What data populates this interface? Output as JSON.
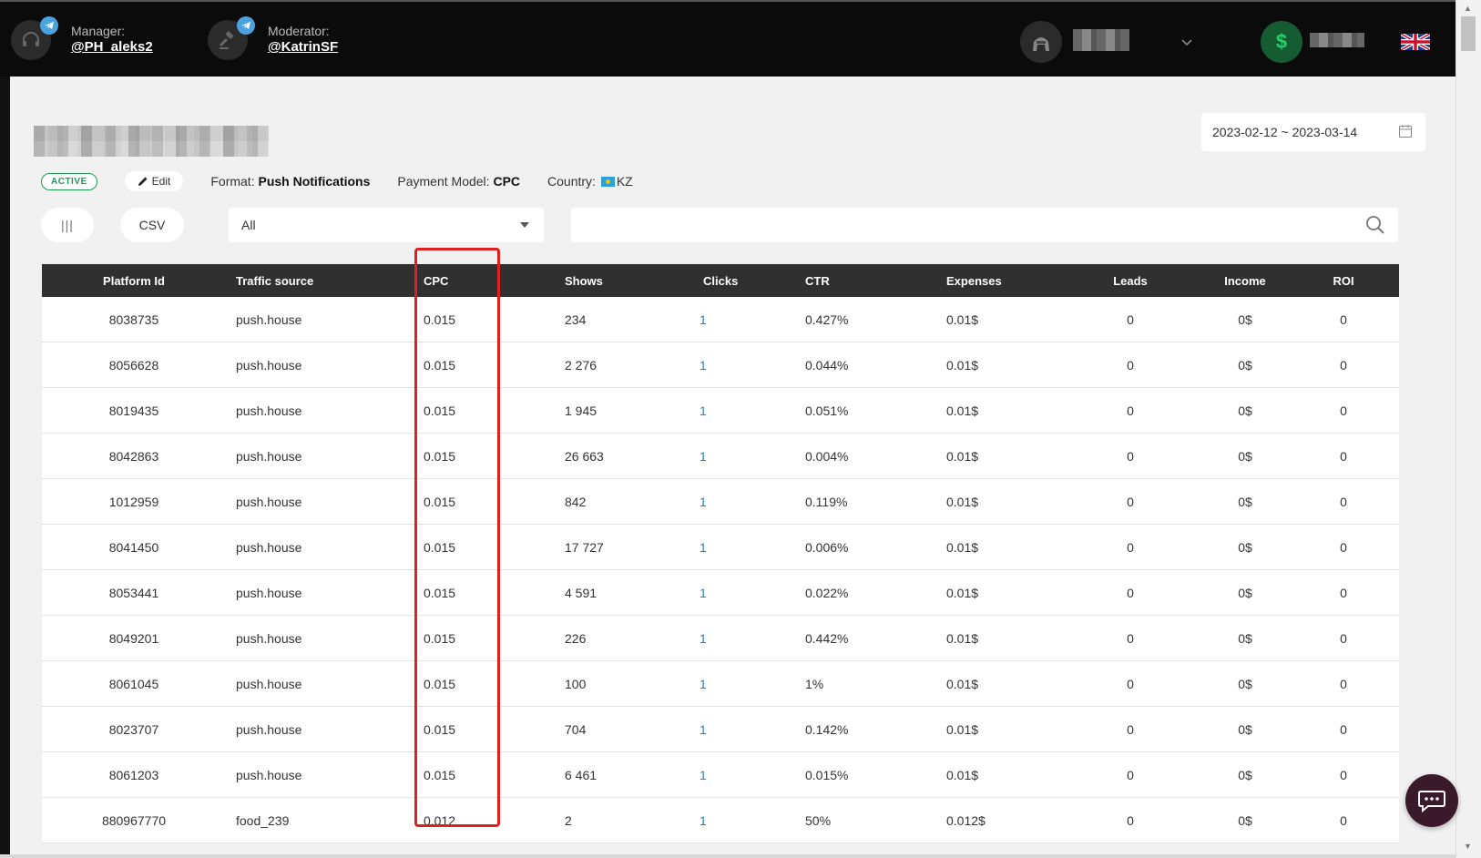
{
  "header": {
    "manager_role": "Manager:",
    "manager_handle": "@PH_aleks2",
    "moderator_role": "Moderator:",
    "moderator_handle": "@KatrinSF"
  },
  "campaign": {
    "status": "ACTIVE",
    "edit_label": "Edit",
    "format_label": "Format:",
    "format_value": "Push Notifications",
    "payment_label": "Payment Model:",
    "payment_value": "CPC",
    "country_label": "Country:",
    "country_value": "KZ"
  },
  "date_range": "2023-02-12 ~ 2023-03-14",
  "toolbar": {
    "columns_label": "|||",
    "csv_label": "CSV",
    "select_value": "All",
    "search_value": ""
  },
  "table": {
    "columns": [
      "Platform Id",
      "Traffic source",
      "CPC",
      "Shows",
      "Clicks",
      "CTR",
      "Expenses",
      "Leads",
      "Income",
      "ROI"
    ],
    "rows": [
      [
        "8038735",
        "push.house",
        "0.015",
        "234",
        "1",
        "0.427%",
        "0.01$",
        "0",
        "0$",
        "0"
      ],
      [
        "8056628",
        "push.house",
        "0.015",
        "2 276",
        "1",
        "0.044%",
        "0.01$",
        "0",
        "0$",
        "0"
      ],
      [
        "8019435",
        "push.house",
        "0.015",
        "1 945",
        "1",
        "0.051%",
        "0.01$",
        "0",
        "0$",
        "0"
      ],
      [
        "8042863",
        "push.house",
        "0.015",
        "26 663",
        "1",
        "0.004%",
        "0.01$",
        "0",
        "0$",
        "0"
      ],
      [
        "1012959",
        "push.house",
        "0.015",
        "842",
        "1",
        "0.119%",
        "0.01$",
        "0",
        "0$",
        "0"
      ],
      [
        "8041450",
        "push.house",
        "0.015",
        "17 727",
        "1",
        "0.006%",
        "0.01$",
        "0",
        "0$",
        "0"
      ],
      [
        "8053441",
        "push.house",
        "0.015",
        "4 591",
        "1",
        "0.022%",
        "0.01$",
        "0",
        "0$",
        "0"
      ],
      [
        "8049201",
        "push.house",
        "0.015",
        "226",
        "1",
        "0.442%",
        "0.01$",
        "0",
        "0$",
        "0"
      ],
      [
        "8061045",
        "push.house",
        "0.015",
        "100",
        "1",
        "1%",
        "0.01$",
        "0",
        "0$",
        "0"
      ],
      [
        "8023707",
        "push.house",
        "0.015",
        "704",
        "1",
        "0.142%",
        "0.01$",
        "0",
        "0$",
        "0"
      ],
      [
        "8061203",
        "push.house",
        "0.015",
        "6 461",
        "1",
        "0.015%",
        "0.01$",
        "0",
        "0$",
        "0"
      ],
      [
        "880967770",
        "food_239",
        "0.012",
        "2",
        "1",
        "50%",
        "0.012$",
        "0",
        "0$",
        "0"
      ]
    ]
  },
  "colors": {
    "header_bg": "#0b0b0b",
    "table_head_bg": "#303030",
    "active_green": "#1e9a55",
    "clicks_blue": "#2c7eb8",
    "highlight_red": "#e02020"
  }
}
